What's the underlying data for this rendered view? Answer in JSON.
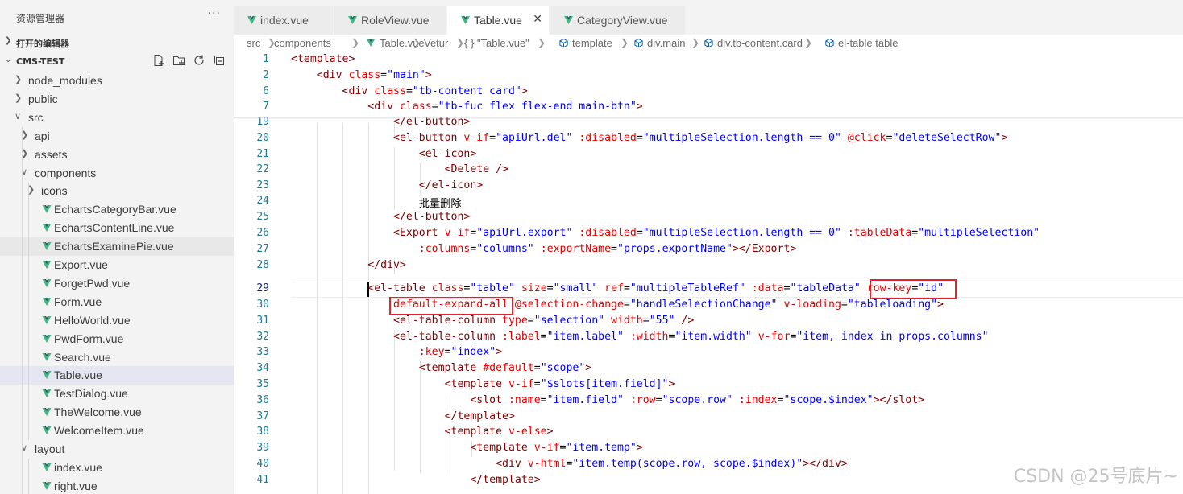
{
  "colors": {
    "vue_icon": "#41b883",
    "sidebar_bg": "#f3f3f3",
    "selected_row": "#e4e6f1",
    "highlight_box": "#e0262a"
  },
  "sidebar": {
    "title": "资源管理器",
    "more": "···",
    "open_editors_label": "打开的编辑器",
    "project_label": "CMS-TEST",
    "action_icons": [
      "new-file-icon",
      "new-folder-icon",
      "refresh-icon",
      "collapse-all-icon"
    ],
    "tree": [
      {
        "label": "node_modules",
        "type": "folder"
      },
      {
        "label": "public",
        "type": "folder"
      },
      {
        "label": "src",
        "type": "folder-open"
      },
      {
        "label": "api",
        "type": "folder"
      },
      {
        "label": "assets",
        "type": "folder"
      },
      {
        "label": "components",
        "type": "folder-open"
      },
      {
        "label": "icons",
        "type": "folder"
      },
      {
        "label": "EchartsCategoryBar.vue",
        "type": "vue"
      },
      {
        "label": "EchartsContentLine.vue",
        "type": "vue"
      },
      {
        "label": "EchartsExaminePie.vue",
        "type": "vue"
      },
      {
        "label": "Export.vue",
        "type": "vue"
      },
      {
        "label": "ForgetPwd.vue",
        "type": "vue"
      },
      {
        "label": "Form.vue",
        "type": "vue"
      },
      {
        "label": "HelloWorld.vue",
        "type": "vue"
      },
      {
        "label": "PwdForm.vue",
        "type": "vue"
      },
      {
        "label": "Search.vue",
        "type": "vue"
      },
      {
        "label": "Table.vue",
        "type": "vue"
      },
      {
        "label": "TestDialog.vue",
        "type": "vue"
      },
      {
        "label": "TheWelcome.vue",
        "type": "vue"
      },
      {
        "label": "WelcomeItem.vue",
        "type": "vue"
      },
      {
        "label": "layout",
        "type": "folder-open"
      },
      {
        "label": "index.vue",
        "type": "vue"
      },
      {
        "label": "right.vue",
        "type": "vue"
      }
    ]
  },
  "tabs": [
    {
      "label": "index.vue"
    },
    {
      "label": "RoleView.vue"
    },
    {
      "label": "Table.vue",
      "close": "✕"
    },
    {
      "label": "CategoryView.vue"
    }
  ],
  "breadcrumb": [
    "src",
    "components",
    "Table.vue",
    "Vetur",
    "{ } \"Table.vue\"",
    "template",
    "div.main",
    "div.tb-content.card",
    "el-table.table"
  ],
  "editor": {
    "lines": [
      {
        "num": "1",
        "parts": [
          [
            "tag",
            "<template>"
          ]
        ]
      },
      {
        "num": "2",
        "parts": [
          [
            "text",
            "    "
          ],
          [
            "tag",
            "<div "
          ],
          [
            "attr",
            "class"
          ],
          [
            "text",
            "="
          ],
          [
            "str",
            "\"main\""
          ],
          [
            "tag",
            ">"
          ]
        ]
      },
      {
        "num": "6",
        "parts": [
          [
            "text",
            "        "
          ],
          [
            "tag",
            "<div "
          ],
          [
            "attr",
            "class"
          ],
          [
            "text",
            "="
          ],
          [
            "str",
            "\"tb-content card\""
          ],
          [
            "tag",
            ">"
          ]
        ]
      },
      {
        "num": "7",
        "parts": [
          [
            "text",
            "            "
          ],
          [
            "tag",
            "<div "
          ],
          [
            "attr",
            "class"
          ],
          [
            "text",
            "="
          ],
          [
            "str",
            "\"tb-fuc flex flex-end main-btn\""
          ],
          [
            "tag",
            ">"
          ]
        ]
      },
      {
        "num": "19",
        "parts": [
          [
            "text",
            "                "
          ],
          [
            "tag",
            "</el-button>"
          ]
        ]
      },
      {
        "num": "20",
        "parts": [
          [
            "text",
            "                "
          ],
          [
            "tag",
            "<el-button "
          ],
          [
            "attr",
            "v-if"
          ],
          [
            "text",
            "="
          ],
          [
            "str",
            "\"apiUrl.del\""
          ],
          [
            "text",
            " "
          ],
          [
            "attr",
            ":disabled"
          ],
          [
            "text",
            "="
          ],
          [
            "str",
            "\"multipleSelection.length == 0\""
          ],
          [
            "text",
            " "
          ],
          [
            "attr",
            "@click"
          ],
          [
            "text",
            "="
          ],
          [
            "str",
            "\"deleteSelectRow\""
          ],
          [
            "tag",
            ">"
          ]
        ]
      },
      {
        "num": "21",
        "parts": [
          [
            "text",
            "                    "
          ],
          [
            "tag",
            "<el-icon>"
          ]
        ]
      },
      {
        "num": "22",
        "parts": [
          [
            "text",
            "                        "
          ],
          [
            "tag",
            "<Delete />"
          ]
        ]
      },
      {
        "num": "23",
        "parts": [
          [
            "text",
            "                    "
          ],
          [
            "tag",
            "</el-icon>"
          ]
        ]
      },
      {
        "num": "24",
        "parts": [
          [
            "text",
            "                    批量删除"
          ]
        ]
      },
      {
        "num": "25",
        "parts": [
          [
            "text",
            "                "
          ],
          [
            "tag",
            "</el-button>"
          ]
        ]
      },
      {
        "num": "26",
        "parts": [
          [
            "text",
            "                "
          ],
          [
            "tag",
            "<Export "
          ],
          [
            "attr",
            "v-if"
          ],
          [
            "text",
            "="
          ],
          [
            "str",
            "\"apiUrl.export\""
          ],
          [
            "text",
            " "
          ],
          [
            "attr",
            ":disabled"
          ],
          [
            "text",
            "="
          ],
          [
            "str",
            "\"multipleSelection.length == 0\""
          ],
          [
            "text",
            " "
          ],
          [
            "attr",
            ":tableData"
          ],
          [
            "text",
            "="
          ],
          [
            "str",
            "\"multipleSelection\""
          ]
        ]
      },
      {
        "num": "27",
        "parts": [
          [
            "text",
            "                    "
          ],
          [
            "attr",
            ":columns"
          ],
          [
            "text",
            "="
          ],
          [
            "str",
            "\"columns\""
          ],
          [
            "text",
            " "
          ],
          [
            "attr",
            ":exportName"
          ],
          [
            "text",
            "="
          ],
          [
            "str",
            "\"props.exportName\""
          ],
          [
            "tag",
            "></Export>"
          ]
        ]
      },
      {
        "num": "28",
        "parts": [
          [
            "text",
            "            "
          ],
          [
            "tag",
            "</div>"
          ]
        ]
      },
      {
        "num": "29",
        "parts": [
          [
            "text",
            "            "
          ],
          [
            "tag",
            "<el-table "
          ],
          [
            "attr",
            "class"
          ],
          [
            "text",
            "="
          ],
          [
            "str",
            "\"table\""
          ],
          [
            "text",
            " "
          ],
          [
            "attr",
            "size"
          ],
          [
            "text",
            "="
          ],
          [
            "str",
            "\"small\""
          ],
          [
            "text",
            " "
          ],
          [
            "attr",
            "ref"
          ],
          [
            "text",
            "="
          ],
          [
            "str",
            "\"multipleTableRef\""
          ],
          [
            "text",
            " "
          ],
          [
            "attr",
            ":data"
          ],
          [
            "text",
            "="
          ],
          [
            "str",
            "\"tableData\""
          ],
          [
            "text",
            " "
          ],
          [
            "attr",
            "row-key"
          ],
          [
            "text",
            "="
          ],
          [
            "str",
            "\"id\""
          ]
        ]
      },
      {
        "num": "30",
        "parts": [
          [
            "text",
            "                "
          ],
          [
            "attr",
            "default-expand-all"
          ],
          [
            "text",
            " "
          ],
          [
            "attr",
            "@selection-change"
          ],
          [
            "text",
            "="
          ],
          [
            "str",
            "\"handleSelectionChange\""
          ],
          [
            "text",
            " "
          ],
          [
            "attr",
            "v-loading"
          ],
          [
            "text",
            "="
          ],
          [
            "str",
            "\"tableloading\""
          ],
          [
            "tag",
            ">"
          ]
        ]
      },
      {
        "num": "31",
        "parts": [
          [
            "text",
            "                "
          ],
          [
            "tag",
            "<el-table-column "
          ],
          [
            "attr",
            "type"
          ],
          [
            "text",
            "="
          ],
          [
            "str",
            "\"selection\""
          ],
          [
            "text",
            " "
          ],
          [
            "attr",
            "width"
          ],
          [
            "text",
            "="
          ],
          [
            "str",
            "\"55\""
          ],
          [
            "text",
            " "
          ],
          [
            "tag",
            "/>"
          ]
        ]
      },
      {
        "num": "32",
        "parts": [
          [
            "text",
            "                "
          ],
          [
            "tag",
            "<el-table-column "
          ],
          [
            "attr",
            ":label"
          ],
          [
            "text",
            "="
          ],
          [
            "str",
            "\"item.label\""
          ],
          [
            "text",
            " "
          ],
          [
            "attr",
            ":width"
          ],
          [
            "text",
            "="
          ],
          [
            "str",
            "\"item.width\""
          ],
          [
            "text",
            " "
          ],
          [
            "attr",
            "v-for"
          ],
          [
            "text",
            "="
          ],
          [
            "str",
            "\"item, index "
          ],
          [
            "str",
            "in"
          ],
          [
            "str",
            " props.columns\""
          ]
        ]
      },
      {
        "num": "33",
        "parts": [
          [
            "text",
            "                    "
          ],
          [
            "attr",
            ":key"
          ],
          [
            "text",
            "="
          ],
          [
            "str",
            "\"index\""
          ],
          [
            "tag",
            ">"
          ]
        ]
      },
      {
        "num": "34",
        "parts": [
          [
            "text",
            "                    "
          ],
          [
            "tag",
            "<template "
          ],
          [
            "attr",
            "#default"
          ],
          [
            "text",
            "="
          ],
          [
            "str",
            "\"scope\""
          ],
          [
            "tag",
            ">"
          ]
        ]
      },
      {
        "num": "35",
        "parts": [
          [
            "text",
            "                        "
          ],
          [
            "tag",
            "<template "
          ],
          [
            "attr",
            "v-if"
          ],
          [
            "text",
            "="
          ],
          [
            "str",
            "\"$slots[item.field]\""
          ],
          [
            "tag",
            ">"
          ]
        ]
      },
      {
        "num": "36",
        "parts": [
          [
            "text",
            "                            "
          ],
          [
            "tag",
            "<slot "
          ],
          [
            "attr",
            ":name"
          ],
          [
            "text",
            "="
          ],
          [
            "str",
            "\"item.field\""
          ],
          [
            "text",
            " "
          ],
          [
            "attr",
            ":row"
          ],
          [
            "text",
            "="
          ],
          [
            "str",
            "\"scope.row\""
          ],
          [
            "text",
            " "
          ],
          [
            "attr",
            ":index"
          ],
          [
            "text",
            "="
          ],
          [
            "str",
            "\"scope.$index\""
          ],
          [
            "tag",
            "></slot>"
          ]
        ]
      },
      {
        "num": "37",
        "parts": [
          [
            "text",
            "                        "
          ],
          [
            "tag",
            "</template>"
          ]
        ]
      },
      {
        "num": "38",
        "parts": [
          [
            "text",
            "                        "
          ],
          [
            "tag",
            "<template "
          ],
          [
            "attr",
            "v-else"
          ],
          [
            "tag",
            ">"
          ]
        ]
      },
      {
        "num": "39",
        "parts": [
          [
            "text",
            "                            "
          ],
          [
            "tag",
            "<template "
          ],
          [
            "attr",
            "v-if"
          ],
          [
            "text",
            "="
          ],
          [
            "str",
            "\"item.temp\""
          ],
          [
            "tag",
            ">"
          ]
        ]
      },
      {
        "num": "40",
        "parts": [
          [
            "text",
            "                                "
          ],
          [
            "tag",
            "<div "
          ],
          [
            "attr",
            "v-html"
          ],
          [
            "text",
            "="
          ],
          [
            "str",
            "\"item.temp(scope.row, scope.$index)\""
          ],
          [
            "tag",
            "></div>"
          ]
        ]
      },
      {
        "num": "41",
        "parts": [
          [
            "text",
            "                            "
          ],
          [
            "tag",
            "</template>"
          ]
        ]
      }
    ]
  },
  "watermark": "CSDN @25号底片~"
}
